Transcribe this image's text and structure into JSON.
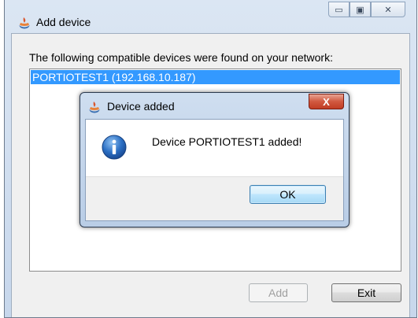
{
  "window": {
    "title": "Add device",
    "minimize_glyph": "▭",
    "maximize_glyph": "▣",
    "close_glyph": "✕"
  },
  "main": {
    "found_label": "The following compatible devices were found on your network:",
    "devices": [
      {
        "label": "PORTIOTEST1 (192.168.10.187)",
        "selected": true
      }
    ],
    "add_label": "Add",
    "exit_label": "Exit"
  },
  "dialog": {
    "title": "Device added",
    "close_glyph": "X",
    "message": "Device PORTIOTEST1 added!",
    "ok_label": "OK",
    "icon": "info-icon"
  },
  "colors": {
    "selection": "#3399ff",
    "close_button": "#c13e24"
  }
}
